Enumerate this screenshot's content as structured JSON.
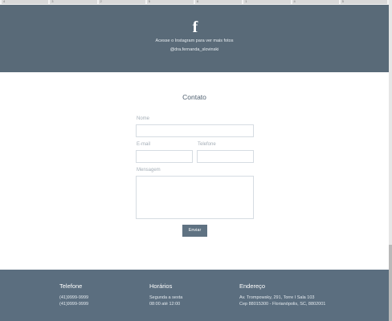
{
  "thumbnails": [
    "4",
    "3",
    "2",
    "5",
    "6",
    "1",
    "4",
    "5"
  ],
  "instagram": {
    "text": "Acesse o Instagram para ver mais fotos",
    "handle": "@dra.fernanda_slovinski"
  },
  "contact": {
    "title": "Contato",
    "name_label": "Nome",
    "email_label": "E-mail",
    "phone_label": "Telefone",
    "message_label": "Mensagem",
    "send_label": "Enviar"
  },
  "footer": {
    "phone": {
      "heading": "Telefone",
      "lines": [
        "(41)9999-9999",
        "(41)9999-9999"
      ]
    },
    "hours": {
      "heading": "Horários",
      "lines": [
        "Segunda a sexta",
        "08:00 até 12:00"
      ]
    },
    "address": {
      "heading": "Endereço",
      "lines": [
        "Av. Trompowsky, 291, Torre I Sala 103",
        "Cep 88015300 - Florianópolis, SC, 8802001"
      ]
    }
  },
  "colors": {
    "band": "#596a78",
    "footer": "#5b6e7f",
    "button": "#5f7282"
  }
}
